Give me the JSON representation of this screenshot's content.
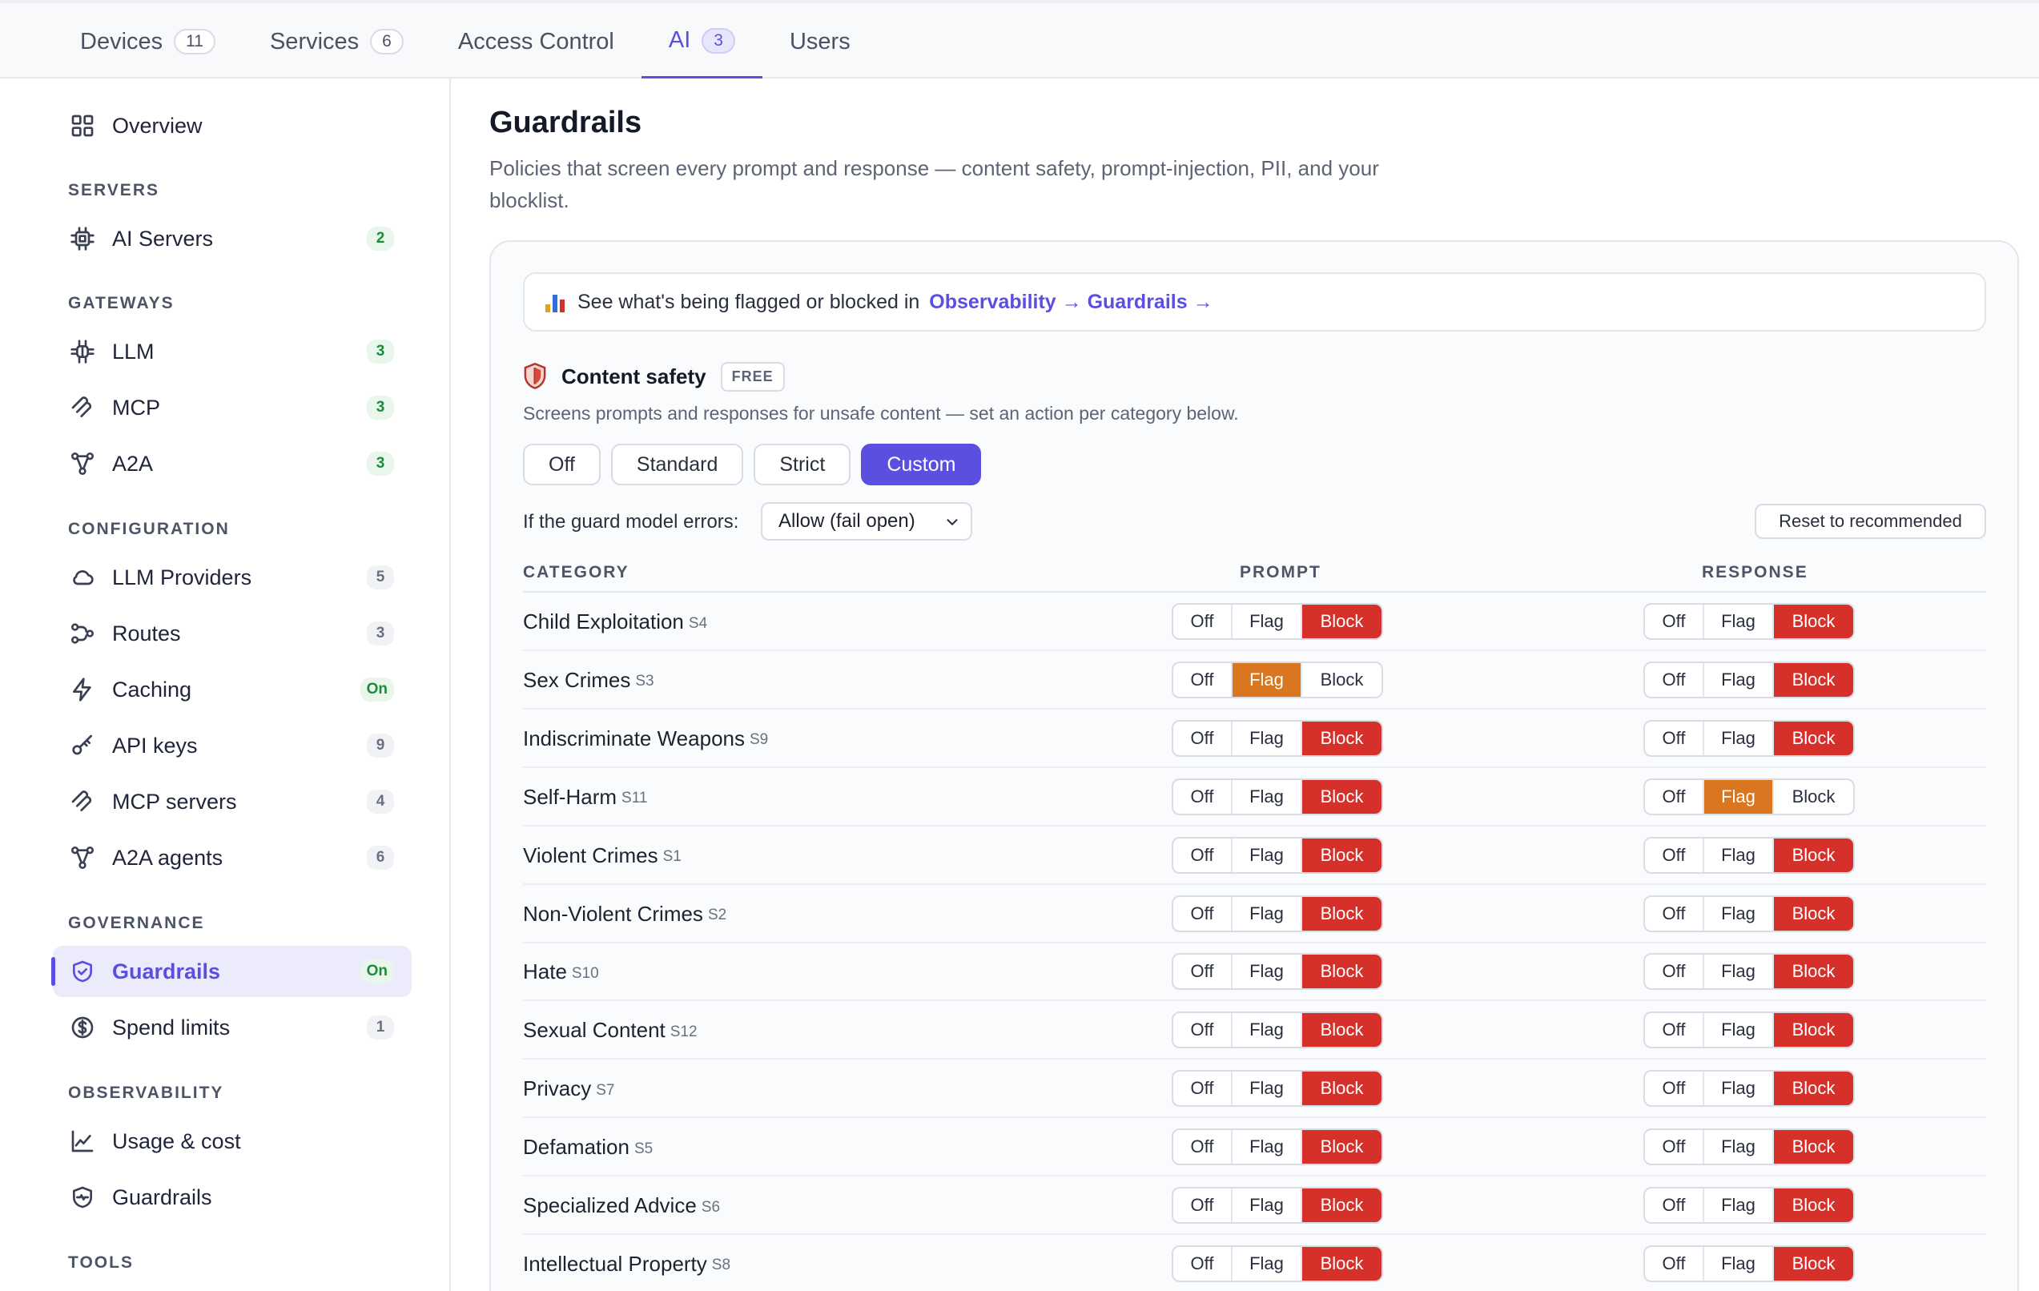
{
  "tabs": [
    {
      "label": "Devices",
      "count": "11"
    },
    {
      "label": "Services",
      "count": "6"
    },
    {
      "label": "Access Control",
      "count": ""
    },
    {
      "label": "AI",
      "count": "3",
      "active": true
    },
    {
      "label": "Users",
      "count": ""
    }
  ],
  "sidebar": {
    "overview": "Overview",
    "groups": {
      "servers": "SERVERS",
      "gateways": "GATEWAYS",
      "configuration": "CONFIGURATION",
      "governance": "GOVERNANCE",
      "observability": "OBSERVABILITY",
      "tools": "TOOLS"
    },
    "items": {
      "ai_servers": {
        "label": "AI Servers",
        "badge": "2"
      },
      "llm": {
        "label": "LLM",
        "badge": "3"
      },
      "mcp": {
        "label": "MCP",
        "badge": "3"
      },
      "a2a": {
        "label": "A2A",
        "badge": "3"
      },
      "llm_providers": {
        "label": "LLM Providers",
        "badge": "5"
      },
      "routes": {
        "label": "Routes",
        "badge": "3"
      },
      "caching": {
        "label": "Caching",
        "badge": "On"
      },
      "api_keys": {
        "label": "API keys",
        "badge": "9"
      },
      "mcp_servers": {
        "label": "MCP servers",
        "badge": "4"
      },
      "a2a_agents": {
        "label": "A2A agents",
        "badge": "6"
      },
      "guardrails": {
        "label": "Guardrails",
        "badge": "On"
      },
      "spend_limits": {
        "label": "Spend limits",
        "badge": "1"
      },
      "usage_cost": {
        "label": "Usage & cost"
      },
      "obs_guardrails": {
        "label": "Guardrails"
      }
    }
  },
  "page": {
    "title": "Guardrails",
    "subtitle": "Policies that screen every prompt and response — content safety, prompt-injection, PII, and your blocklist."
  },
  "observability_banner": {
    "text": "See what's being flagged or blocked in",
    "link": "Observability → Guardrails →"
  },
  "content_safety": {
    "title": "Content safety",
    "tier": "FREE",
    "description": "Screens prompts and responses for unsafe content — set an action per category below.",
    "presets": [
      "Off",
      "Standard",
      "Strict",
      "Custom"
    ],
    "active_preset": "Custom",
    "error_label": "If the guard model errors:",
    "error_value": "Allow (fail open)",
    "reset_label": "Reset to recommended",
    "columns": {
      "category": "CATEGORY",
      "prompt": "PROMPT",
      "response": "RESPONSE"
    },
    "options": [
      "Off",
      "Flag",
      "Block"
    ],
    "rows": [
      {
        "name": "Child Exploitation",
        "code": "S4",
        "prompt": "Block",
        "response": "Block"
      },
      {
        "name": "Sex Crimes",
        "code": "S3",
        "prompt": "Flag",
        "response": "Block"
      },
      {
        "name": "Indiscriminate Weapons",
        "code": "S9",
        "prompt": "Block",
        "response": "Block"
      },
      {
        "name": "Self-Harm",
        "code": "S11",
        "prompt": "Block",
        "response": "Flag"
      },
      {
        "name": "Violent Crimes",
        "code": "S1",
        "prompt": "Block",
        "response": "Block"
      },
      {
        "name": "Non-Violent Crimes",
        "code": "S2",
        "prompt": "Block",
        "response": "Block"
      },
      {
        "name": "Hate",
        "code": "S10",
        "prompt": "Block",
        "response": "Block"
      },
      {
        "name": "Sexual Content",
        "code": "S12",
        "prompt": "Block",
        "response": "Block"
      },
      {
        "name": "Privacy",
        "code": "S7",
        "prompt": "Block",
        "response": "Block"
      },
      {
        "name": "Defamation",
        "code": "S5",
        "prompt": "Block",
        "response": "Block"
      },
      {
        "name": "Specialized Advice",
        "code": "S6",
        "prompt": "Block",
        "response": "Block"
      },
      {
        "name": "Intellectual Property",
        "code": "S8",
        "prompt": "Block",
        "response": "Block"
      }
    ]
  },
  "colors": {
    "accent": "#5b4fe0",
    "block": "#d6302b",
    "flag": "#da761f"
  }
}
